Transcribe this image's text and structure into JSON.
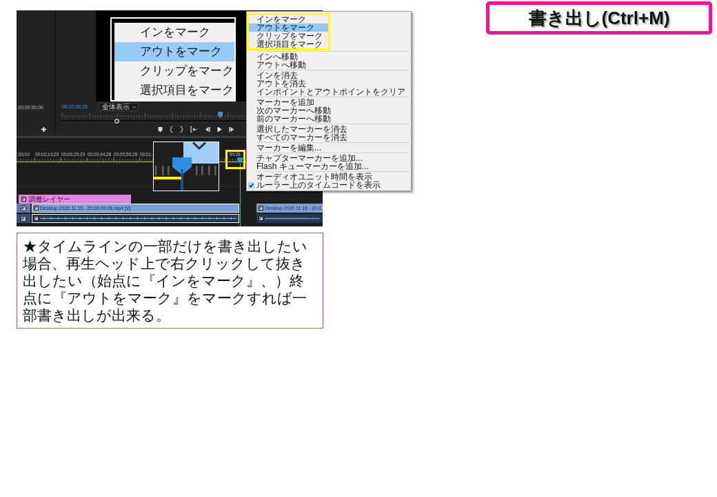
{
  "title_banner": {
    "text": "書き出し(Ctrl+M)"
  },
  "source_monitor": {
    "timecode": "00;00;00;00"
  },
  "program_monitor": {
    "timecode": "00;02;06;23",
    "view_dropdown": "全体表示",
    "playhead": {
      "level": 0.61
    }
  },
  "zoom_inset": {
    "items": [
      {
        "label": "インをマーク",
        "selected": false
      },
      {
        "label": "アウトをマーク",
        "selected": true
      },
      {
        "label": "クリップをマーク",
        "selected": false
      },
      {
        "label": "選択項目をマーク",
        "selected": false
      }
    ]
  },
  "context_menu": {
    "groups": [
      {
        "framed": true,
        "items": [
          {
            "label": "インをマーク",
            "selected": false,
            "checked": false
          },
          {
            "label": "アウトをマーク",
            "selected": true,
            "checked": false
          },
          {
            "label": "クリップをマーク",
            "selected": false,
            "checked": false
          },
          {
            "label": "選択項目をマーク",
            "selected": false,
            "checked": false
          }
        ]
      },
      {
        "framed": false,
        "items": [
          {
            "label": "インへ移動",
            "selected": false,
            "checked": false
          },
          {
            "label": "アウトへ移動",
            "selected": false,
            "checked": false
          }
        ]
      },
      {
        "framed": false,
        "items": [
          {
            "label": "インを消去",
            "selected": false,
            "checked": false
          },
          {
            "label": "アウトを消去",
            "selected": false,
            "checked": false
          },
          {
            "label": "インポイントとアウトポイントをクリア",
            "selected": false,
            "checked": false
          }
        ]
      },
      {
        "framed": false,
        "items": [
          {
            "label": "マーカーを追加",
            "selected": false,
            "checked": false
          },
          {
            "label": "次のマーカーへ移動",
            "selected": false,
            "checked": false
          },
          {
            "label": "前のマーカーへ移動",
            "selected": false,
            "checked": false
          }
        ]
      },
      {
        "framed": false,
        "items": [
          {
            "label": "選択したマーカーを消去",
            "selected": false,
            "checked": false
          },
          {
            "label": "すべてのマーカーを消去",
            "selected": false,
            "checked": false
          }
        ]
      },
      {
        "framed": false,
        "items": [
          {
            "label": "マーカーを編集...",
            "selected": false,
            "checked": false
          }
        ]
      },
      {
        "framed": false,
        "items": [
          {
            "label": "チャプターマーカーを追加...",
            "selected": false,
            "checked": false
          },
          {
            "label": "Flash キューマーカーを追加...",
            "selected": false,
            "checked": false
          }
        ]
      },
      {
        "framed": false,
        "items": [
          {
            "label": "オーディオユニット時間を表示",
            "selected": false,
            "checked": false
          },
          {
            "label": "ルーラー上のタイムコードを表示",
            "selected": false,
            "checked": true
          }
        ]
      }
    ]
  },
  "timeline": {
    "ruler_labels": [
      ";00;00",
      "00;00;14;29",
      "00;00;29;29",
      "00;00;44;28",
      "00;00;59;28",
      "00;01;",
      "59;28"
    ],
    "playhead": {
      "level": 0.73,
      "framed": true
    },
    "tracks": [
      {
        "kind": "adjustment",
        "clips": [
          {
            "label": "調整レイヤー",
            "selected": false
          }
        ]
      },
      {
        "kind": "video",
        "clips": [
          {
            "label": "Desktop 2020.11.15 - 20.09.09.06.mp4 [V]",
            "selected": true
          },
          {
            "label": "Desktop 2020.11.15 - 20.0",
            "selected": false
          }
        ]
      },
      {
        "kind": "audio",
        "clips": [
          {
            "selected": true
          },
          {
            "selected": false
          }
        ]
      }
    ]
  },
  "note": {
    "text": "★タイムラインの一部だけを書き出したい場合、再生ヘッド上で右クリックして抜き出したい（始点に『インをマーク』、）終点に『アウトをマーク』をマークすれば一部書き出しが出来る。"
  }
}
